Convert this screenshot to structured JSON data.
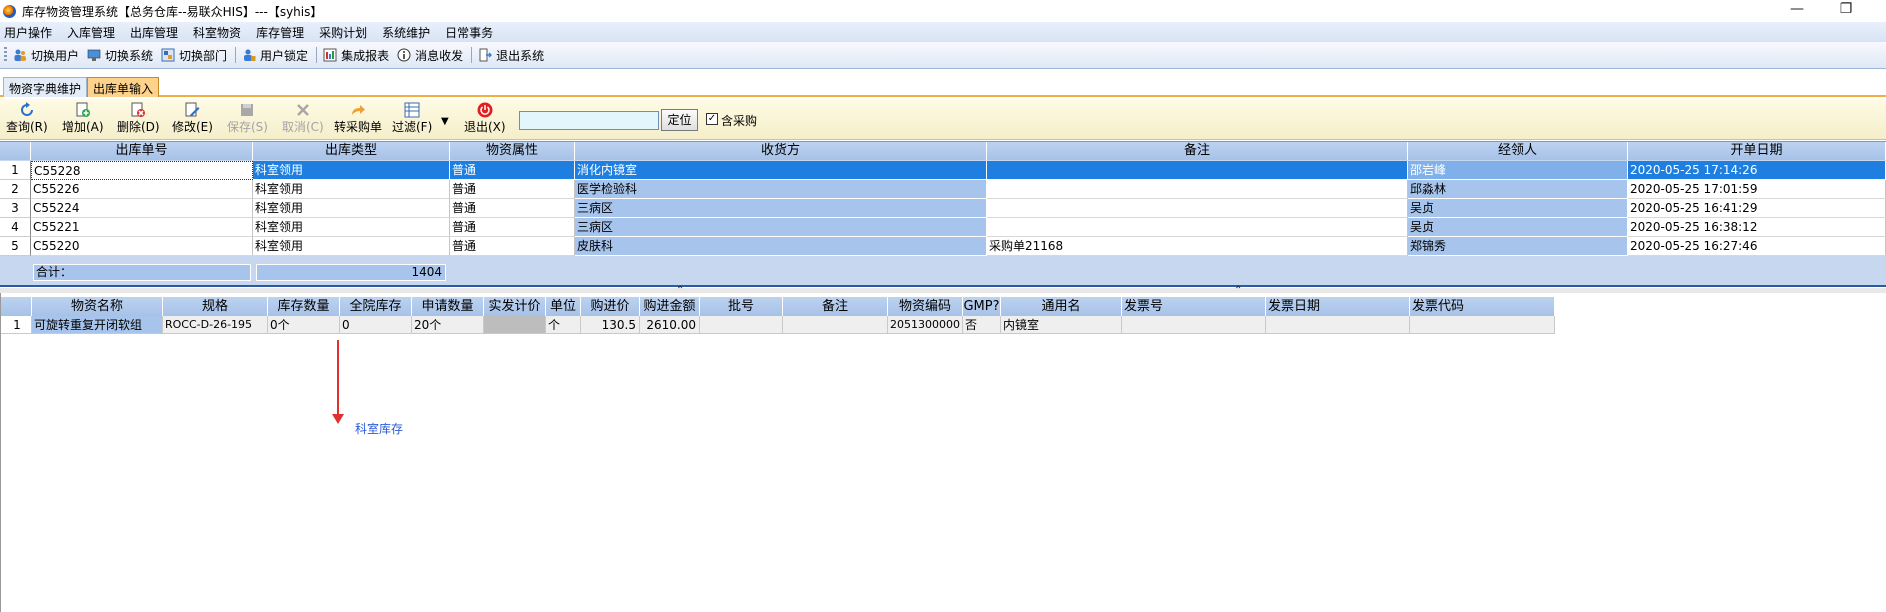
{
  "window": {
    "title": "库存物资管理系统【总务仓库--易联众HIS】---【syhis】",
    "minimize": "—",
    "restore": "❐"
  },
  "menu": [
    "用户操作",
    "入库管理",
    "出库管理",
    "科室物资",
    "库存管理",
    "采购计划",
    "系统维护",
    "日常事务"
  ],
  "quickbar": [
    {
      "label": "切换用户",
      "icon": "users-icon"
    },
    {
      "label": "切换系统",
      "icon": "switch-system-icon"
    },
    {
      "label": "切换部门",
      "icon": "switch-dept-icon"
    },
    {
      "label": "用户锁定",
      "icon": "user-lock-icon"
    },
    {
      "label": "集成报表",
      "icon": "report-icon"
    },
    {
      "label": "消息收发",
      "icon": "info-icon"
    },
    {
      "label": "退出系统",
      "icon": "exit-icon"
    }
  ],
  "tabs": [
    {
      "label": "物资字典维护",
      "active": false
    },
    {
      "label": "出库单输入",
      "active": true
    }
  ],
  "toolbar": {
    "query": "查询(R)",
    "add": "增加(A)",
    "delete": "删除(D)",
    "edit": "修改(E)",
    "save": "保存(S)",
    "cancel": "取消(C)",
    "to_purchase": "转采购单",
    "filter": "过滤(F)",
    "exit": "退出(X)",
    "search_value": "",
    "locate": "定位",
    "include_purchase_label": "含采购",
    "include_purchase_checked": true
  },
  "grid1": {
    "headers": [
      "出库单号",
      "出库类型",
      "物资属性",
      "收货方",
      "备注",
      "经领人",
      "开单日期"
    ],
    "rows": [
      {
        "n": "1",
        "no": "C55228",
        "type": "科室领用",
        "attr": "普通",
        "receiver": "消化内镜室",
        "note": "",
        "person": "邵岩峰",
        "date": "2020-05-25 17:14:26"
      },
      {
        "n": "2",
        "no": "C55226",
        "type": "科室领用",
        "attr": "普通",
        "receiver": "医学检验科",
        "note": "",
        "person": "邱淼林",
        "date": "2020-05-25 17:01:59"
      },
      {
        "n": "3",
        "no": "C55224",
        "type": "科室领用",
        "attr": "普通",
        "receiver": "三病区",
        "note": "",
        "person": "吴贞",
        "date": "2020-05-25 16:41:29"
      },
      {
        "n": "4",
        "no": "C55221",
        "type": "科室领用",
        "attr": "普通",
        "receiver": "三病区",
        "note": "",
        "person": "吴贞",
        "date": "2020-05-25 16:38:12"
      },
      {
        "n": "5",
        "no": "C55220",
        "type": "科室领用",
        "attr": "普通",
        "receiver": "皮肤科",
        "note": "采购单21168",
        "person": "郑锦秀",
        "date": "2020-05-25 16:27:46"
      }
    ],
    "summary_label": "合计：",
    "summary_value": "1404"
  },
  "grid2": {
    "headers": [
      "物资名称",
      "规格",
      "库存数量",
      "全院库存",
      "申请数量",
      "实发计价",
      "单位",
      "购进价",
      "购进金额",
      "批号",
      "备注",
      "物资编码",
      "GMP?",
      "通用名",
      "发票号",
      "发票日期",
      "发票代码"
    ],
    "rows": [
      {
        "n": "1",
        "name": "可旋转重复开闭软组",
        "spec": "ROCC-D-26-195",
        "stock": "0个",
        "hosp_stock": "0",
        "req": "20个",
        "actual": "",
        "unit": "个",
        "price": "130.5",
        "amount": "2610.00",
        "batch": "",
        "note": "",
        "code": "2051300000",
        "gmp": "否",
        "generic": "内镜室",
        "inv_no": "",
        "inv_date": "",
        "inv_code": ""
      }
    ]
  },
  "annotation": "科室库存"
}
